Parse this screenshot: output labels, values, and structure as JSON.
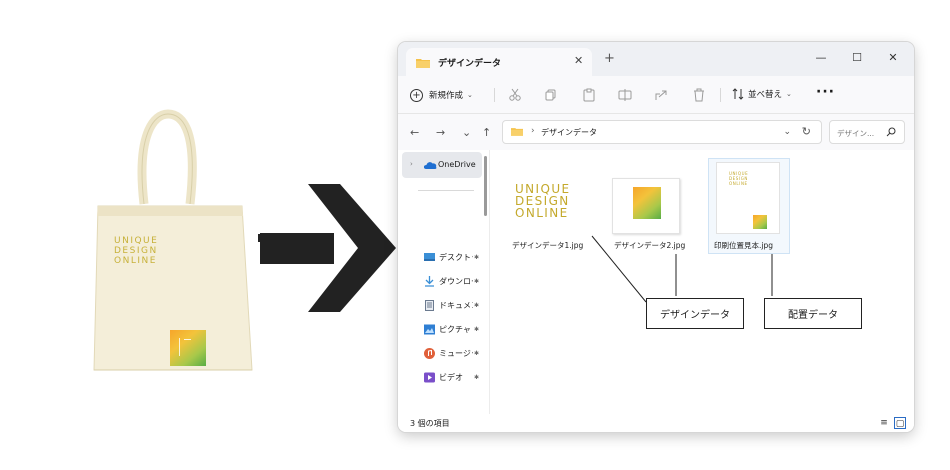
{
  "window": {
    "tab_title": "デザインデータ",
    "tab_close": "✕",
    "tab_add": "+",
    "minimize": "—",
    "maximize": "☐",
    "close": "✕"
  },
  "toolbar": {
    "new_label": "新規作成",
    "new_chevron": "⌄",
    "sort_label": "並べ替え",
    "sort_chevron": "⌄",
    "more": "···"
  },
  "nav": {
    "back": "←",
    "forward": "→",
    "history": "⌄",
    "up": "↑",
    "path_sep": "›",
    "path": "デザインデータ",
    "path_dropdown": "⌄",
    "refresh": "↻",
    "search_placeholder": "デザイン..."
  },
  "sidebar": {
    "expand": "›",
    "onedrive": "OneDrive",
    "pin": "📌",
    "items": [
      {
        "label": "デスクトップ",
        "icon": "desktop-icon",
        "color": "#3a8fd6"
      },
      {
        "label": "ダウンロード",
        "icon": "download-icon",
        "color": "#3a8fd6"
      },
      {
        "label": "ドキュメント",
        "icon": "document-icon",
        "color": "#6b7a8f"
      },
      {
        "label": "ピクチャ",
        "icon": "picture-icon",
        "color": "#2f7fd3"
      },
      {
        "label": "ミュージック",
        "icon": "music-icon",
        "color": "#e0603a"
      },
      {
        "label": "ビデオ",
        "icon": "video-icon",
        "color": "#7a4fc9"
      }
    ]
  },
  "files": [
    {
      "name": "デザインデータ1.jpg",
      "kind": "text-logo"
    },
    {
      "name": "デザインデータ2.jpg",
      "kind": "square-logo"
    },
    {
      "name": "印刷位置見本.jpg",
      "kind": "position-sample"
    }
  ],
  "logo_text": [
    "UNIQUE",
    "DESIGN",
    "ONLINE"
  ],
  "status": {
    "count": "3 個の項目",
    "view_details": "≡",
    "view_large": "▢"
  },
  "callouts": {
    "design_data": "デザインデータ",
    "placement_data": "配置データ"
  },
  "colors": {
    "logo_gold": "#c4a92c",
    "logo_orange": "#f6a52a",
    "logo_green": "#58ad45",
    "folder_yellow": "#f5c24a",
    "bag_canvas": "#f4eed9"
  }
}
